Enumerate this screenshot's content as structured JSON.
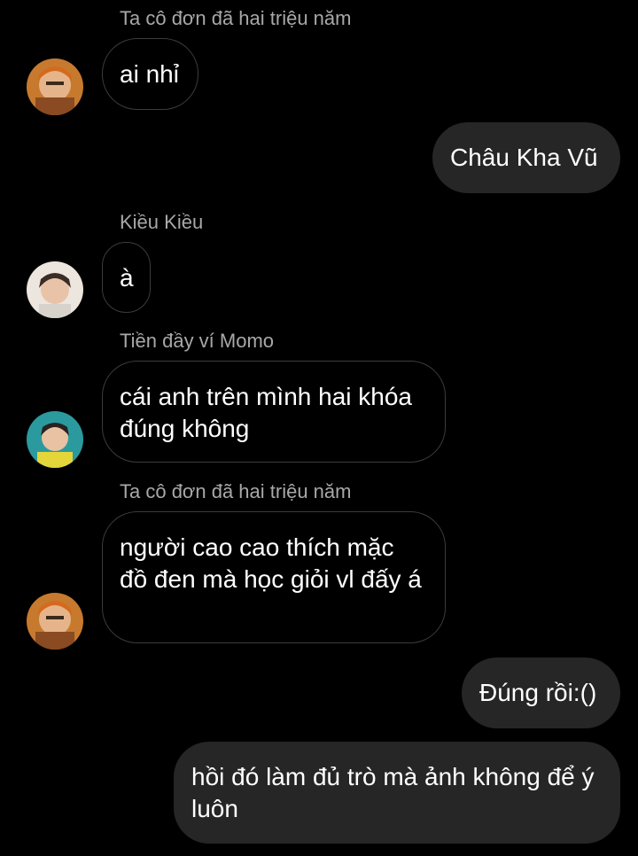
{
  "colors": {
    "background": "#000000",
    "incoming_border": "#3c3c3c",
    "outgoing_bubble": "#262626",
    "sender_name": "#a8a8a8"
  },
  "messages": [
    {
      "direction": "incoming",
      "sender": "Ta cô đơn đã hai triệu năm",
      "text": "ai nhỉ",
      "avatar": "avatar-orange-hair"
    },
    {
      "direction": "outgoing",
      "text": "Châu Kha Vũ"
    },
    {
      "direction": "incoming",
      "sender": "Kiều Kiều",
      "text": "à",
      "avatar": "avatar-light-background"
    },
    {
      "direction": "incoming",
      "sender": "Tiền đầy ví Momo",
      "text": "cái anh trên mình hai khóa đúng không",
      "avatar": "avatar-teal-background"
    },
    {
      "direction": "incoming",
      "sender": "Ta cô đơn đã hai triệu năm",
      "text": "người cao cao thích mặc đồ đen mà học giỏi vl đấy á",
      "avatar": "avatar-orange-hair"
    },
    {
      "direction": "outgoing",
      "text": "Đúng rồi:()"
    },
    {
      "direction": "outgoing",
      "text": "hồi đó làm đủ trò mà ảnh không để ý luôn"
    }
  ]
}
